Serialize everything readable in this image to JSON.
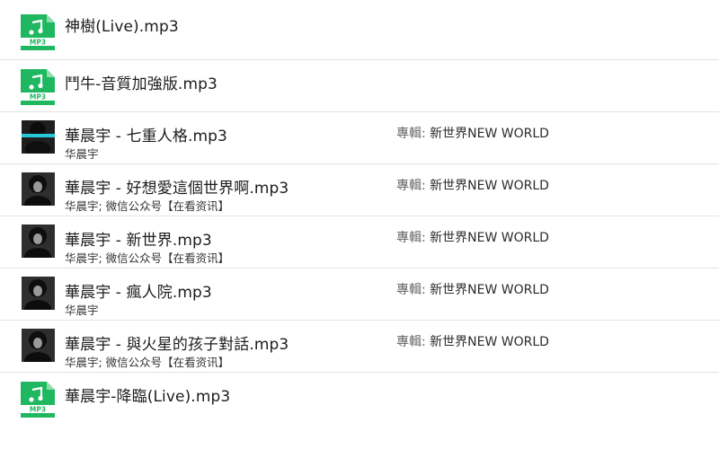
{
  "files": [
    {
      "title": "神樹(Live).mp3",
      "icon": "mp3-file-icon"
    },
    {
      "title": "鬥牛-音質加強版.mp3",
      "icon": "mp3-file-icon"
    },
    {
      "title": "華晨宇 - 七重人格.mp3",
      "artist": "华晨宇",
      "album_label": "專輯:",
      "album": "新世界NEW WORLD",
      "icon": "album-cover"
    },
    {
      "title": "華晨宇 - 好想愛這個世界啊.mp3",
      "artist": "华晨宇; 微信公众号【在看资讯】",
      "album_label": "專輯:",
      "album": "新世界NEW WORLD",
      "icon": "album-cover"
    },
    {
      "title": "華晨宇 - 新世界.mp3",
      "artist": "华晨宇; 微信公众号【在看资讯】",
      "album_label": "專輯:",
      "album": "新世界NEW WORLD",
      "icon": "album-cover"
    },
    {
      "title": "華晨宇 - 瘋人院.mp3",
      "artist": "华晨宇",
      "album_label": "專輯:",
      "album": "新世界NEW WORLD",
      "icon": "album-cover"
    },
    {
      "title": "華晨宇 - 與火星的孩子對話.mp3",
      "artist": "华晨宇; 微信公众号【在看资讯】",
      "album_label": "專輯:",
      "album": "新世界NEW WORLD",
      "icon": "album-cover"
    },
    {
      "title": "華晨宇-降臨(Live).mp3",
      "icon": "mp3-file-icon"
    }
  ],
  "mp3_badge": "MP3",
  "colors": {
    "mp3_green": "#1fb760",
    "cover_bg": "#2b2b2b",
    "cover_accent": "#27c6d8"
  }
}
